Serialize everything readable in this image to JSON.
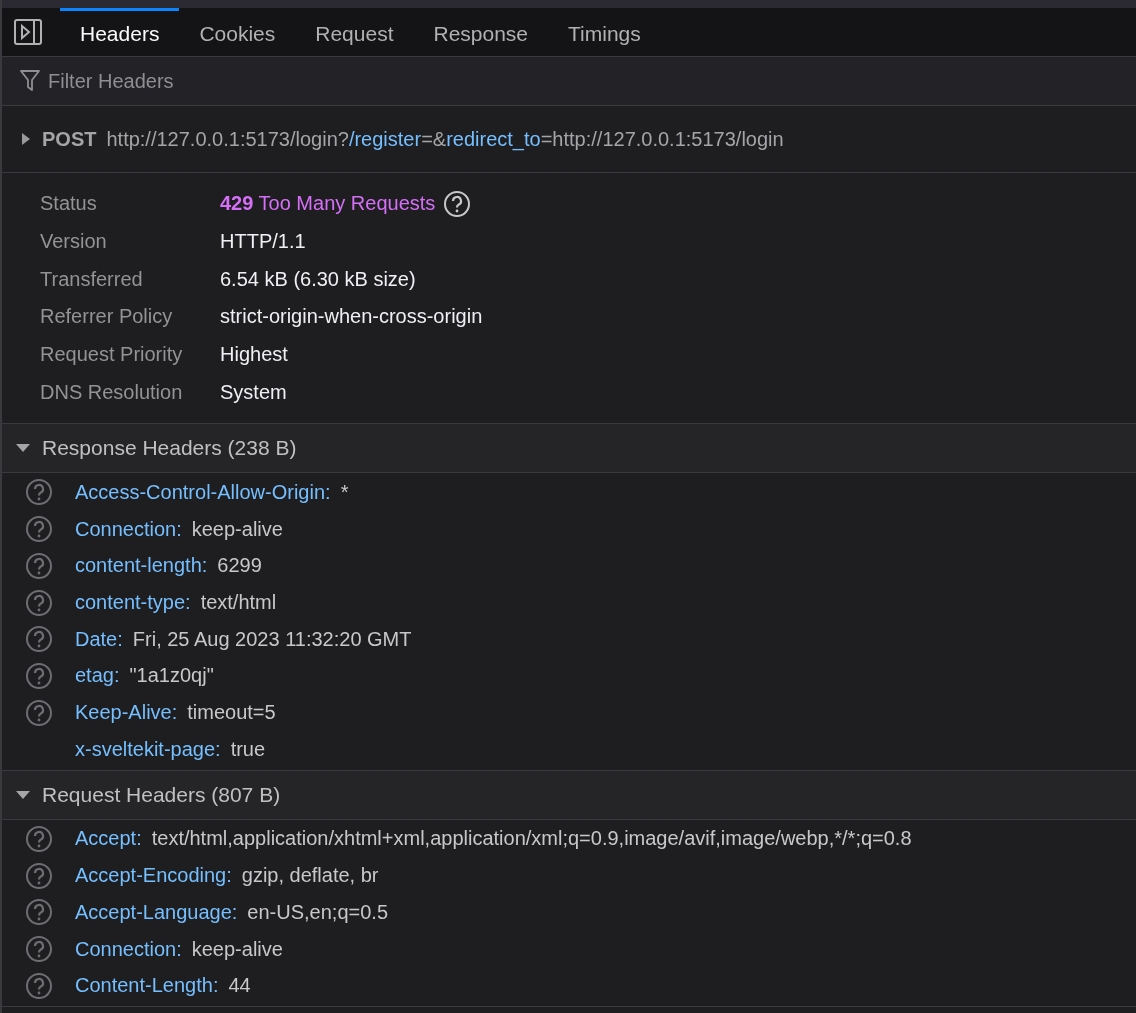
{
  "tabs": [
    {
      "label": "Headers",
      "selected": true
    },
    {
      "label": "Cookies",
      "selected": false
    },
    {
      "label": "Request",
      "selected": false
    },
    {
      "label": "Response",
      "selected": false
    },
    {
      "label": "Timings",
      "selected": false
    }
  ],
  "filter": {
    "placeholder": "Filter Headers"
  },
  "request": {
    "expanded": false,
    "method": "POST",
    "url": [
      {
        "text": "http://127.0.0.1:5173/login",
        "kind": "plain"
      },
      {
        "text": "?",
        "kind": "plain"
      },
      {
        "text": "/register",
        "kind": "param"
      },
      {
        "text": "=&",
        "kind": "plain"
      },
      {
        "text": "redirect_to",
        "kind": "param"
      },
      {
        "text": "=http://127.0.0.1:5173/login",
        "kind": "plain"
      }
    ]
  },
  "summary": [
    {
      "label": "Status",
      "kind": "status",
      "code": "429",
      "value": "Too Many Requests"
    },
    {
      "label": "Version",
      "kind": "plain",
      "value": "HTTP/1.1"
    },
    {
      "label": "Transferred",
      "kind": "plain",
      "value": "6.54 kB (6.30 kB size)"
    },
    {
      "label": "Referrer Policy",
      "kind": "plain",
      "value": "strict-origin-when-cross-origin"
    },
    {
      "label": "Request Priority",
      "kind": "plain",
      "value": "Highest"
    },
    {
      "label": "DNS Resolution",
      "kind": "plain",
      "value": "System"
    }
  ],
  "sections": [
    {
      "title": "Response Headers (238 B)",
      "expanded": true,
      "headers": [
        {
          "name": "Access-Control-Allow-Origin:",
          "value": "*",
          "help": true
        },
        {
          "name": "Connection:",
          "value": "keep-alive",
          "help": true
        },
        {
          "name": "content-length:",
          "value": "6299",
          "help": true
        },
        {
          "name": "content-type:",
          "value": "text/html",
          "help": true
        },
        {
          "name": "Date:",
          "value": "Fri, 25 Aug 2023 11:32:20 GMT",
          "help": true
        },
        {
          "name": "etag:",
          "value": "\"1a1z0qj\"",
          "help": true
        },
        {
          "name": "Keep-Alive:",
          "value": "timeout=5",
          "help": true
        },
        {
          "name": "x-sveltekit-page:",
          "value": "true",
          "help": false
        }
      ]
    },
    {
      "title": "Request Headers (807 B)",
      "expanded": true,
      "headers": [
        {
          "name": "Accept:",
          "value": "text/html,application/xhtml+xml,application/xml;q=0.9,image/avif,image/webp,*/*;q=0.8",
          "help": true
        },
        {
          "name": "Accept-Encoding:",
          "value": "gzip, deflate, br",
          "help": true
        },
        {
          "name": "Accept-Language:",
          "value": "en-US,en;q=0.5",
          "help": true
        },
        {
          "name": "Connection:",
          "value": "keep-alive",
          "help": true
        },
        {
          "name": "Content-Length:",
          "value": "44",
          "help": true
        }
      ]
    }
  ]
}
